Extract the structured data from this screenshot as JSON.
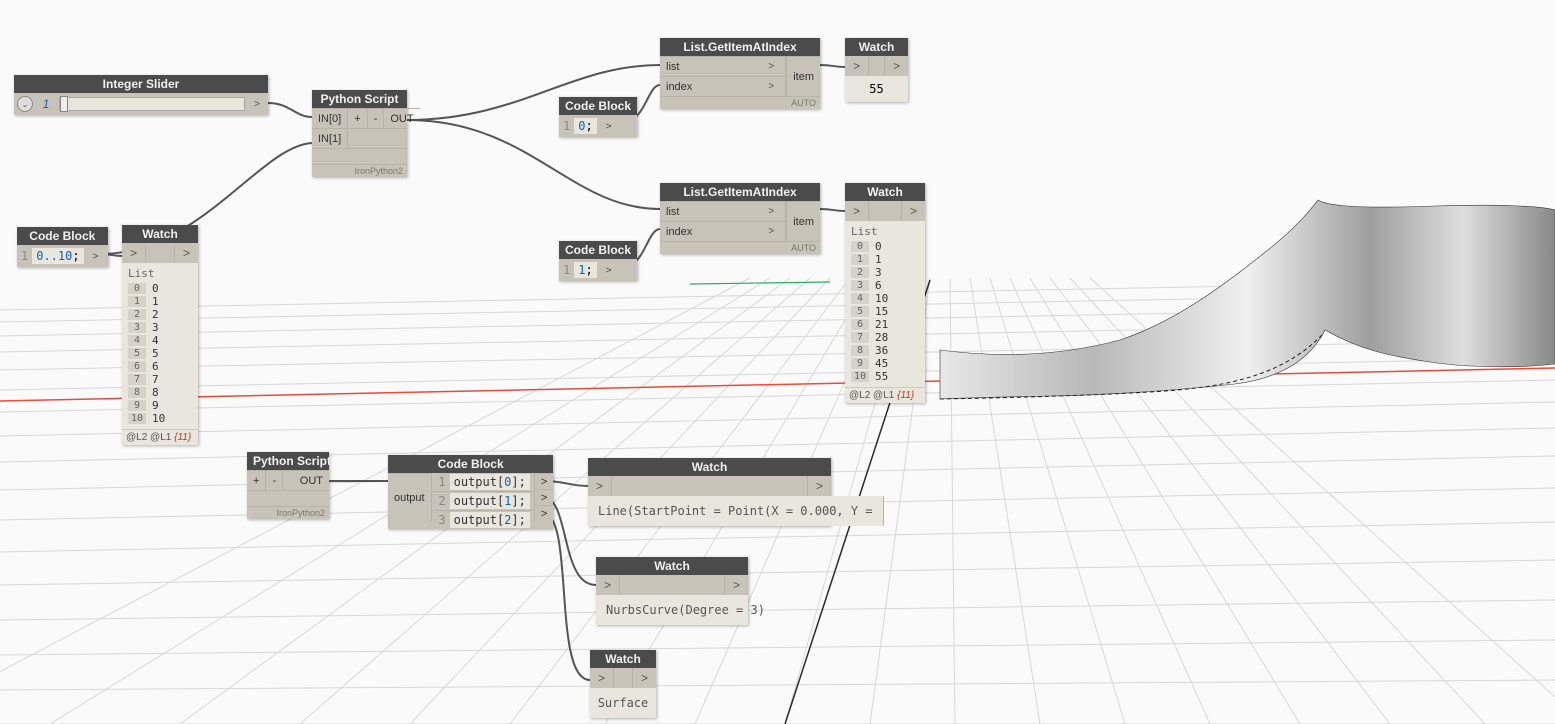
{
  "nodes": {
    "integer_slider": {
      "title": "Integer Slider",
      "value": "1",
      "out_chev": ">"
    },
    "code_block_range": {
      "title": "Code Block",
      "line_no": "1",
      "code_prefix": "0..10",
      "code_suffix": ";",
      "out_chev": ">"
    },
    "python1": {
      "title": "Python Script",
      "in0": "IN[0]",
      "in1": "IN[1]",
      "plus": "+",
      "minus": "-",
      "out": "OUT",
      "engine": "IronPython2"
    },
    "python2": {
      "title": "Python Script",
      "plus": "+",
      "minus": "-",
      "out": "OUT",
      "engine": "IronPython2"
    },
    "watch_list_0_10": {
      "title": "Watch",
      "in_chev": ">",
      "out_chev": ">",
      "list_label": "List",
      "items": [
        {
          "ix": "0",
          "v": "0"
        },
        {
          "ix": "1",
          "v": "1"
        },
        {
          "ix": "2",
          "v": "2"
        },
        {
          "ix": "3",
          "v": "3"
        },
        {
          "ix": "4",
          "v": "4"
        },
        {
          "ix": "5",
          "v": "5"
        },
        {
          "ix": "6",
          "v": "6"
        },
        {
          "ix": "7",
          "v": "7"
        },
        {
          "ix": "8",
          "v": "8"
        },
        {
          "ix": "9",
          "v": "9"
        },
        {
          "ix": "10",
          "v": "10"
        }
      ],
      "foot_levels": "@L2 @L1",
      "foot_count": "{11}"
    },
    "code_block_0": {
      "title": "Code Block",
      "line_no": "1",
      "value": "0",
      "suffix": ";",
      "out_chev": ">"
    },
    "code_block_1": {
      "title": "Code Block",
      "line_no": "1",
      "value": "1",
      "suffix": ";",
      "out_chev": ">"
    },
    "get_item_1": {
      "title": "List.GetItemAtIndex",
      "p_list": "list",
      "p_index": "index",
      "p_item": "item",
      "chev": ">",
      "foot": "AUTO"
    },
    "get_item_2": {
      "title": "List.GetItemAtIndex",
      "p_list": "list",
      "p_index": "index",
      "p_item": "item",
      "chev": ">",
      "foot": "AUTO"
    },
    "watch_55": {
      "title": "Watch",
      "in_chev": ">",
      "out_chev": ">",
      "value": "55"
    },
    "watch_tri": {
      "title": "Watch",
      "in_chev": ">",
      "out_chev": ">",
      "list_label": "List",
      "items": [
        {
          "ix": "0",
          "v": "0"
        },
        {
          "ix": "1",
          "v": "1"
        },
        {
          "ix": "2",
          "v": "3"
        },
        {
          "ix": "3",
          "v": "6"
        },
        {
          "ix": "4",
          "v": "10"
        },
        {
          "ix": "5",
          "v": "15"
        },
        {
          "ix": "6",
          "v": "21"
        },
        {
          "ix": "7",
          "v": "28"
        },
        {
          "ix": "8",
          "v": "36"
        },
        {
          "ix": "9",
          "v": "45"
        },
        {
          "ix": "10",
          "v": "55"
        }
      ],
      "foot_levels": "@L2 @L1",
      "foot_count": "{11}"
    },
    "code_block_output": {
      "title": "Code Block",
      "in_label": "output",
      "rows": [
        {
          "ln": "1",
          "t_pre": "output[",
          "idx": "0",
          "t_post": "];"
        },
        {
          "ln": "2",
          "t_pre": "output[",
          "idx": "1",
          "t_post": "];"
        },
        {
          "ln": "3",
          "t_pre": "output[",
          "idx": "2",
          "t_post": "];"
        }
      ],
      "out_chev": ">"
    },
    "watch_line": {
      "title": "Watch",
      "in_chev": ">",
      "out_chev": ">",
      "text": "Line(StartPoint = Point(X = 0.000, Y ="
    },
    "watch_nurbs": {
      "title": "Watch",
      "in_chev": ">",
      "out_chev": ">",
      "text": "NurbsCurve(Degree = 3)"
    },
    "watch_surface": {
      "title": "Watch",
      "in_chev": ">",
      "out_chev": ">",
      "text": "Surface"
    }
  }
}
